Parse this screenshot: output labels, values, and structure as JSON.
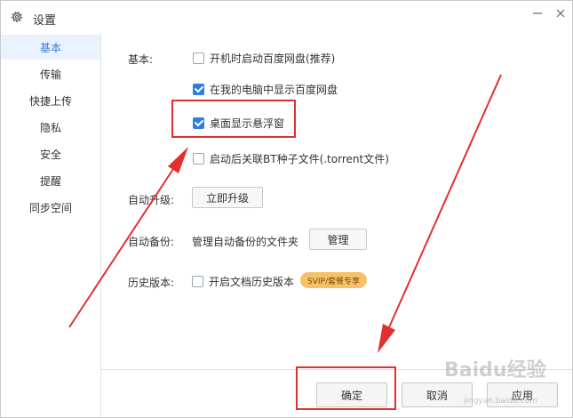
{
  "window": {
    "title": "设置"
  },
  "sidebar": {
    "items": [
      {
        "label": "基本",
        "active": true
      },
      {
        "label": "传输"
      },
      {
        "label": "快捷上传"
      },
      {
        "label": "隐私"
      },
      {
        "label": "安全"
      },
      {
        "label": "提醒"
      },
      {
        "label": "同步空间"
      }
    ]
  },
  "basic": {
    "label": "基本:",
    "options": [
      {
        "label": "开机时启动百度网盘(推荐)",
        "checked": false
      },
      {
        "label": "在我的电脑中显示百度网盘",
        "checked": true
      },
      {
        "label": "桌面显示悬浮窗",
        "checked": true
      },
      {
        "label": "启动后关联BT种子文件(.torrent文件)",
        "checked": false
      }
    ]
  },
  "auto_upgrade": {
    "label": "自动升级:",
    "button": "立即升级"
  },
  "auto_backup": {
    "label": "自动备份:",
    "text": "管理自动备份的文件夹",
    "button": "管理"
  },
  "history": {
    "label": "历史版本:",
    "option": "开启文档历史版本",
    "checked": false,
    "badge": "SVIP/套餐专享"
  },
  "footer": {
    "ok": "确定",
    "cancel": "取消",
    "apply": "应用"
  },
  "watermark": {
    "main": "Baidu经验",
    "sub": "jingyan.baidu.com"
  },
  "colors": {
    "accent": "#2f7de1",
    "highlight": "#e0312f",
    "sidebar_active_bg": "#eaf3fd",
    "badge_bg": "#f5c26b"
  }
}
